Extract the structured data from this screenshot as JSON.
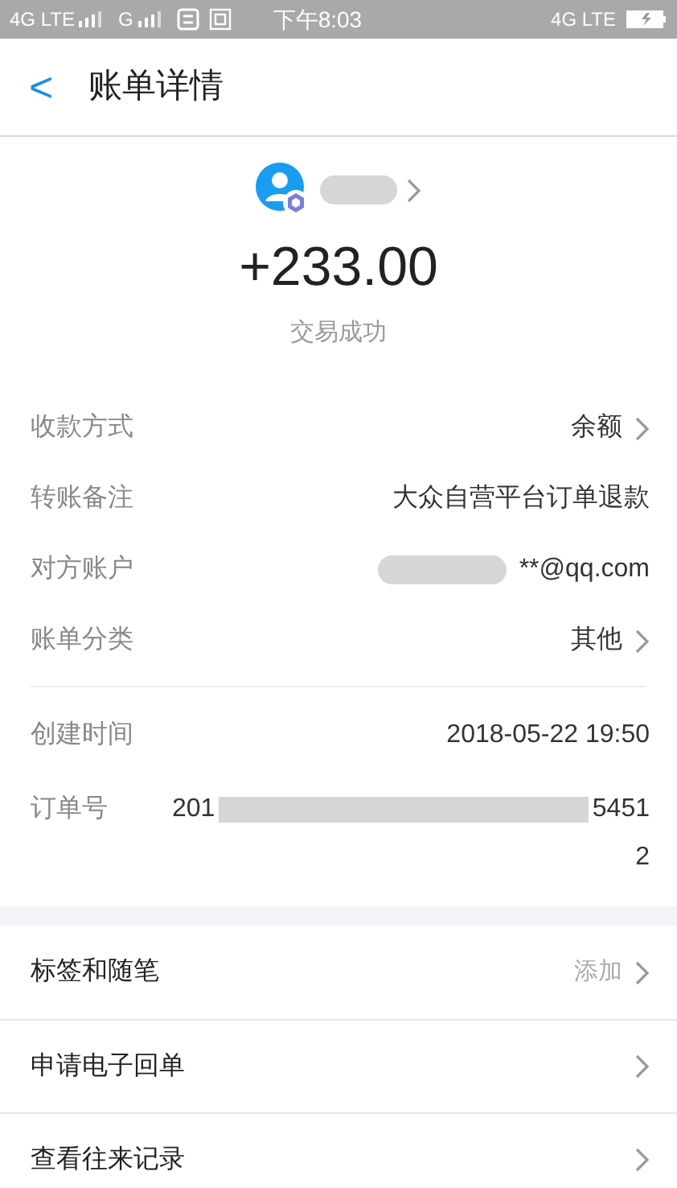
{
  "status_bar": {
    "left": [
      "4G LTE",
      "G"
    ],
    "time": "下午8:03",
    "right": "4G LTE"
  },
  "header": {
    "back": "<",
    "title": "账单详情"
  },
  "summary": {
    "amount": "+233.00",
    "status": "交易成功"
  },
  "details": [
    {
      "label": "收款方式",
      "value": "余额",
      "chevron": true
    },
    {
      "label": "转账备注",
      "value": "大众自营平台订单退款",
      "chevron": false
    },
    {
      "label": "对方账户",
      "value": "**@qq.com",
      "chevron": false,
      "blurred": true
    }
  ],
  "category": {
    "label": "账单分类",
    "value": "其他",
    "chevron": true
  },
  "meta": [
    {
      "label": "创建时间",
      "value": "2018-05-22 19:50"
    },
    {
      "label": "订单号",
      "prefix": "201",
      "suffix": "5451",
      "wrap": "2"
    }
  ],
  "actions": [
    {
      "label": "标签和随笔",
      "value": "添加"
    },
    {
      "label": "申请电子回单"
    },
    {
      "label": "查看往来记录"
    }
  ]
}
